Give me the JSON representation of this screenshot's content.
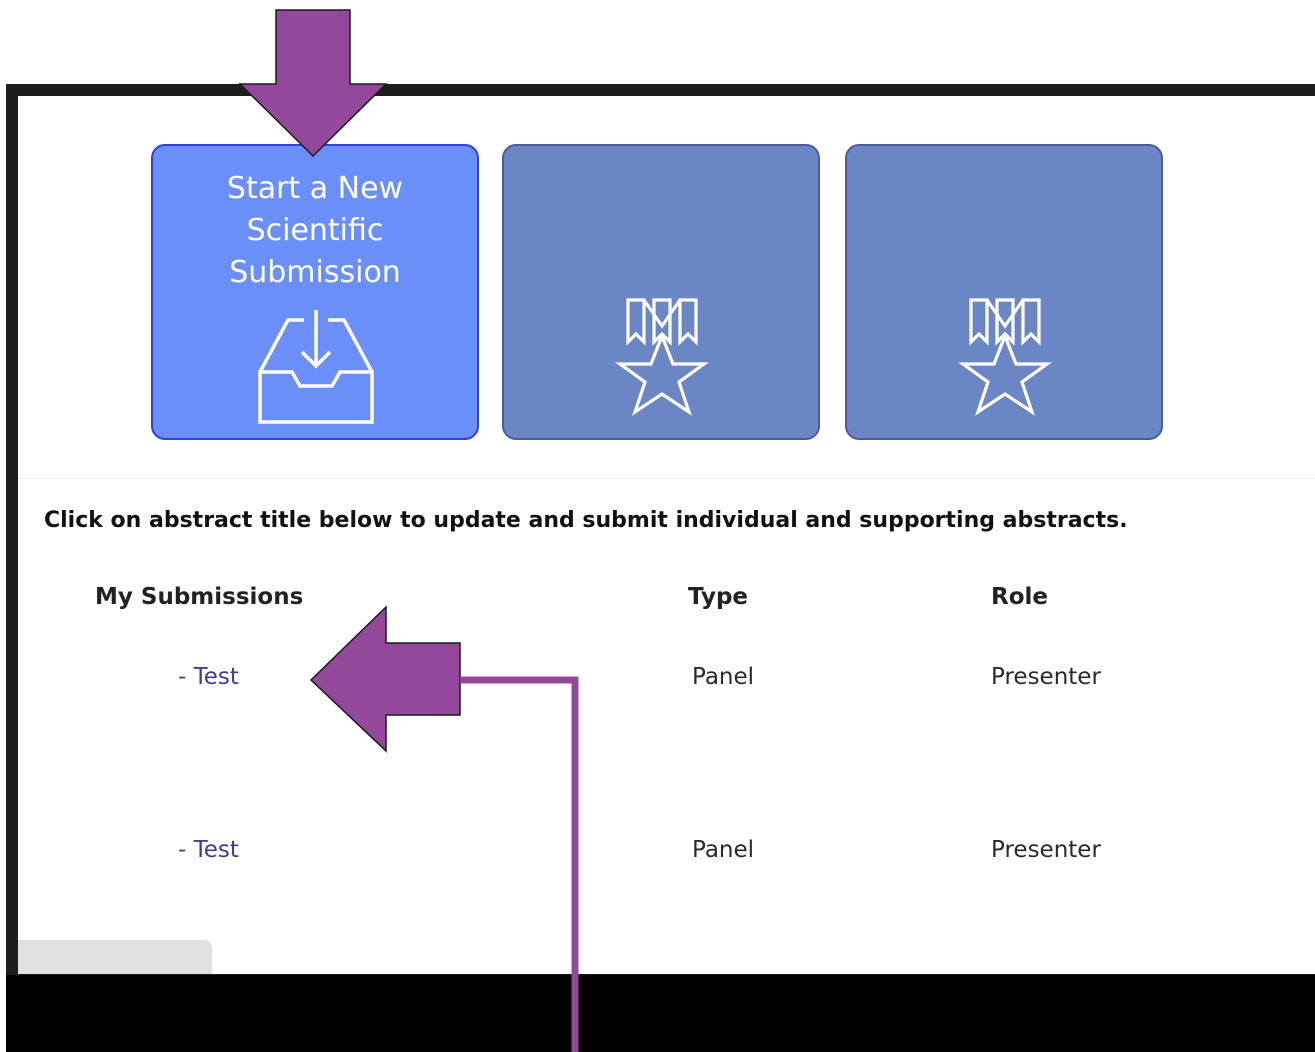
{
  "tiles": {
    "primary_label": "Start a New\nScientific\nSubmission",
    "primary_icon": "inbox-download-icon",
    "award_icon": "award-medal-star-icon",
    "primary_color": "#6a8ff9",
    "secondary_color": "#6a86c5"
  },
  "instructions": "Click on abstract title below to update and submit individual and supporting abstracts.",
  "table": {
    "headers": [
      "My Submissions",
      "Type",
      "Role"
    ],
    "rows": [
      {
        "title": "- Test",
        "type": "Panel",
        "role": "Presenter"
      },
      {
        "title": "- Test",
        "type": "Panel",
        "role": "Presenter"
      }
    ]
  },
  "annotations": {
    "arrow_color": "#94489c",
    "arrow_icons": [
      "down-arrow-annotation",
      "left-arrow-annotation"
    ]
  }
}
